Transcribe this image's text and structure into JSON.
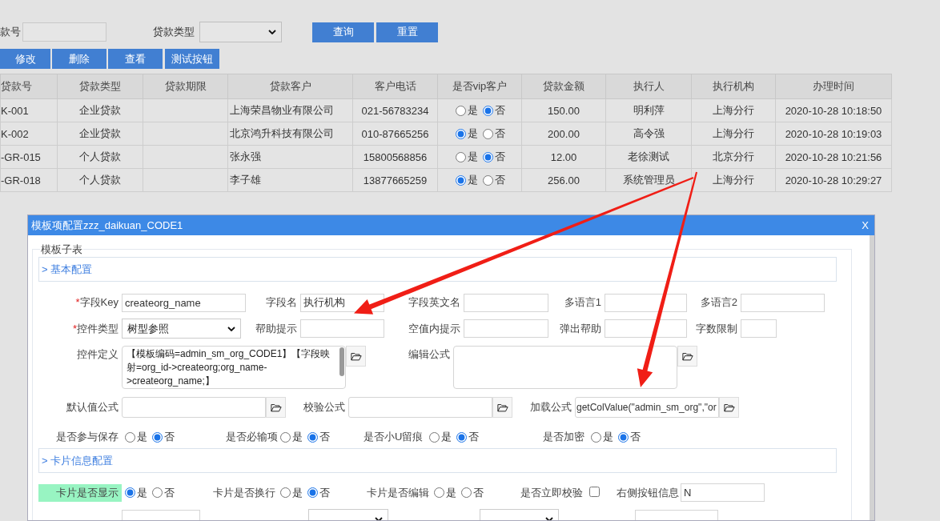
{
  "search": {
    "fields": [
      {
        "kind": "text",
        "label": "款号"
      },
      {
        "kind": "select",
        "label": "贷款类型"
      }
    ],
    "buttons": [
      "查询",
      "重置"
    ]
  },
  "toolbar": [
    "修改",
    "删除",
    "查看",
    "测试按钮"
  ],
  "table": {
    "columns": [
      "贷款号",
      "贷款类型",
      "贷款期限",
      "贷款客户",
      "客户电话",
      "是否vip客户",
      "贷款金额",
      "执行人",
      "执行机构",
      "办理时间"
    ],
    "rows": [
      {
        "cells": [
          "K-001",
          "企业贷款",
          null,
          "上海荣昌物业有限公司",
          "021-56783234",
          {
            "kind": "radio",
            "options": [
              {
                "label": "是",
                "selected": false
              },
              {
                "label": "否",
                "selected": true
              }
            ]
          },
          "150.00",
          "明利萍",
          "上海分行",
          "2020-10-28 10:18:50"
        ]
      },
      {
        "cells": [
          "K-002",
          "企业贷款",
          null,
          "北京鸿升科技有限公司",
          "010-87665256",
          {
            "kind": "radio",
            "options": [
              {
                "label": "是",
                "selected": true
              },
              {
                "label": "否",
                "selected": false
              }
            ]
          },
          "200.00",
          "高令强",
          "上海分行",
          "2020-10-28 10:19:03"
        ]
      },
      {
        "cells": [
          "-GR-015",
          "个人贷款",
          null,
          "张永强",
          "15800568856",
          {
            "kind": "radio",
            "options": [
              {
                "label": "是",
                "selected": false
              },
              {
                "label": "否",
                "selected": true
              }
            ]
          },
          "12.00",
          "老徐测试",
          "北京分行",
          "2020-10-28 10:21:56"
        ]
      },
      {
        "cells": [
          "-GR-018",
          "个人贷款",
          null,
          "李子雄",
          "13877665259",
          {
            "kind": "radio",
            "options": [
              {
                "label": "是",
                "selected": true
              },
              {
                "label": "否",
                "selected": false
              }
            ]
          },
          "256.00",
          "系统管理员",
          "上海分行",
          "2020-10-28 10:29:27"
        ]
      }
    ]
  },
  "dialog": {
    "title": "模板项配置zzz_daikuan_CODE1",
    "close": "X",
    "group_title": "模板子表",
    "sections": [
      {
        "title": "> 基本配置",
        "rows": [
          [
            {
              "kind": "text",
              "required_mark": "*",
              "label": "字段Key",
              "value": "createorg_name"
            },
            {
              "kind": "text",
              "label": "字段名",
              "value": "执行机构"
            },
            {
              "kind": "text",
              "label": "字段英文名"
            },
            {
              "kind": "text",
              "label": "多语言1"
            },
            {
              "kind": "text",
              "label": "多语言2"
            }
          ],
          [
            {
              "kind": "select",
              "required_mark": "*",
              "label": "控件类型",
              "value": "树型参照"
            },
            {
              "kind": "text",
              "label": "帮助提示"
            },
            {
              "kind": "text",
              "label": "空值内提示"
            },
            {
              "kind": "text",
              "label": "弹出帮助"
            },
            {
              "kind": "text",
              "label": "字数限制"
            }
          ],
          [
            {
              "kind": "textarea",
              "label": "控件定义",
              "value": "【模板编码=admin_sm_org_CODE1】【字段映射=org_id->createorg;org_name->createorg_name;】"
            },
            null,
            {
              "kind": "textarea",
              "label": "编辑公式"
            }
          ],
          [
            {
              "kind": "browse",
              "label": "默认值公式"
            },
            {
              "kind": "browse",
              "label": "校验公式"
            },
            null,
            {
              "kind": "browse",
              "label": "加载公式",
              "value": "getColValue(\"admin_sm_org\",\"or"
            }
          ],
          [
            {
              "kind": "radio",
              "label": "是否参与保存",
              "options": [
                {
                  "label": "是",
                  "selected": false
                },
                {
                  "label": "否",
                  "selected": true
                }
              ]
            },
            {
              "kind": "radio",
              "label": "是否必输项",
              "options": [
                {
                  "label": "是",
                  "selected": false
                },
                {
                  "label": "否",
                  "selected": true
                }
              ]
            },
            {
              "kind": "radio",
              "label": "是否小U留痕",
              "options": [
                {
                  "label": "是",
                  "selected": false
                },
                {
                  "label": "否",
                  "selected": true
                }
              ]
            },
            {
              "kind": "radio",
              "label": "是否加密",
              "options": [
                {
                  "label": "是",
                  "selected": false
                },
                {
                  "label": "否",
                  "selected": true
                }
              ]
            }
          ]
        ]
      },
      {
        "title": "> 卡片信息配置",
        "rows": [
          [
            {
              "kind": "radio",
              "label": "卡片是否显示",
              "highlighted": true,
              "options": [
                {
                  "label": "是",
                  "selected": true
                },
                {
                  "label": "否",
                  "selected": false
                }
              ]
            },
            {
              "kind": "radio",
              "label": "卡片是否换行",
              "options": [
                {
                  "label": "是",
                  "selected": false
                },
                {
                  "label": "否",
                  "selected": true
                }
              ]
            },
            {
              "kind": "radio",
              "label": "卡片是否编辑",
              "options": [
                {
                  "label": "是",
                  "selected": false
                },
                {
                  "label": "否",
                  "selected": false
                }
              ]
            },
            {
              "kind": "checkbox",
              "label": "是否立即校验",
              "checked": false
            },
            {
              "kind": "text",
              "label": "右侧按钮信息",
              "value": "N"
            }
          ],
          [
            {
              "kind": "text"
            },
            {
              "kind": "select"
            },
            {
              "kind": "select"
            },
            {
              "kind": "text"
            }
          ]
        ]
      }
    ]
  }
}
